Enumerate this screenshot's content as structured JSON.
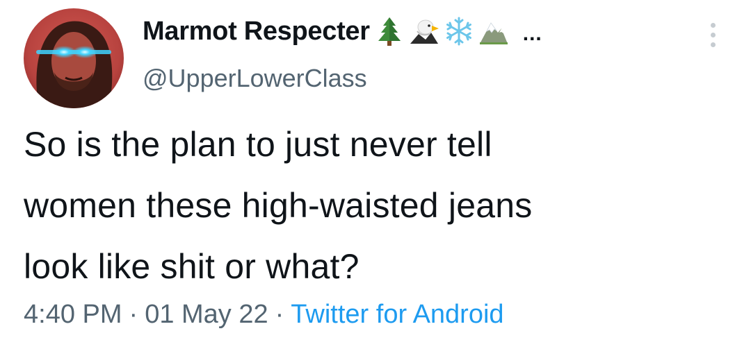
{
  "user": {
    "display_name": "Marmot Respecter",
    "name_emojis": [
      "evergreen-tree-icon",
      "eagle-icon",
      "snowflake-icon",
      "snow-capped-mountain-icon"
    ],
    "name_overflow": "...",
    "handle": "@UpperLowerClass"
  },
  "tweet": {
    "text_lines": [
      "So is the plan to just never tell",
      "women these high-waisted jeans",
      "look like shit or what?"
    ]
  },
  "meta": {
    "time": "4:40 PM",
    "separator": "·",
    "date": "01 May 22",
    "source": "Twitter for Android"
  },
  "colors": {
    "text_primary": "#0f1419",
    "text_secondary": "#536471",
    "link": "#1d9bf0",
    "avatar_bg": "#b8433f",
    "laser_eyes": "#3fd4ff"
  },
  "icons": {
    "more": "more-vertical-icon",
    "avatar": "avatar"
  }
}
